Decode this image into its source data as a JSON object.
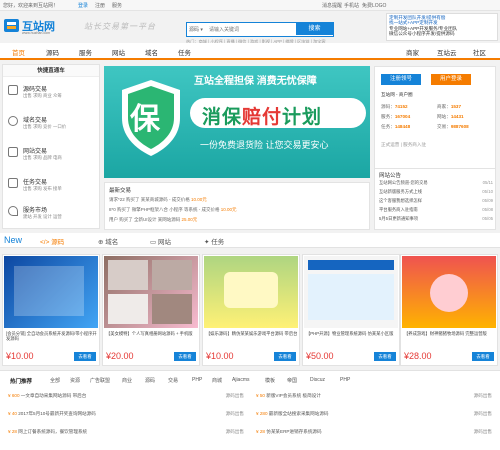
{
  "topbar": {
    "welcome": "您好，欢迎来到互站网！",
    "login": "登录",
    "register": "注册",
    "service": "服务",
    "items": [
      "消息提醒",
      "手机站",
      "免费LOGO",
      "服务中心",
      "网站导航"
    ]
  },
  "ad": {
    "line1": "定制开发团队开发/提供有偿",
    "line2": "找一站式+APP定制开发",
    "line3": "专业网站+APP开发服务/专业团队",
    "line4": "微信公众号小程序开发/提供源码"
  },
  "header": {
    "logo_text": "互站网",
    "logo_sub": "www.huzhan.com",
    "slogan": "站长交易第一平台",
    "search_select": "源码",
    "search_placeholder": "请输入关键词",
    "search_button": "搜索",
    "hot_keywords": "热门：商城 | 小程序 | 直播 | 微信 | 游戏 | 影视 | APP | 棋牌 | 区块链 | 淘宝客"
  },
  "nav": {
    "items": [
      "首页",
      "源码",
      "服务",
      "网站",
      "域名",
      "任务"
    ],
    "right_items": [
      "商家",
      "互站云",
      "社区"
    ]
  },
  "leftmenu": {
    "title": "快捷直通车",
    "cats": [
      {
        "title": "源码交易",
        "sub": "出售 求购 商业 众筹"
      },
      {
        "title": "域名交易",
        "sub": "出售 求购 竞价 一口价"
      },
      {
        "title": "网站交易",
        "sub": "出售 求购 品牌 电商"
      },
      {
        "title": "任务交易",
        "sub": "出售 求购 发布 接单"
      },
      {
        "title": "服务市场",
        "sub": "建站 开发 设计 运营"
      }
    ]
  },
  "banner": {
    "tagline": "互站全程担保  消费无忧保障",
    "headline_a": "消保",
    "headline_b": "赔付",
    "headline_c": "计划",
    "sub": "一份免费退货险  让您交易更安心",
    "shield_char": "保"
  },
  "userbox": {
    "login_button": "注册领号",
    "register_button": "用户登录",
    "greeting": "互站网 - 商户圈",
    "stats": [
      {
        "label": "源码",
        "value": "74152",
        "label2": "商家",
        "value2": "1537"
      },
      {
        "label": "服务",
        "value": "167004",
        "label2": "网站",
        "value2": "14431"
      },
      {
        "label": "任务",
        "value": "148448",
        "label2": "交易",
        "value2": "9887608"
      }
    ]
  },
  "notices": {
    "tabs": "正式运营 | 服务商入驻",
    "title": "网站公告",
    "items": [
      {
        "text": "互站网公告频道-您的交易",
        "date": "05/11"
      },
      {
        "text": "互站新版服务方式上线",
        "date": "05/10"
      },
      {
        "text": "这个客服我想选择怎样",
        "date": "05/09"
      },
      {
        "text": "平台服务商入驻指南",
        "date": "05/08"
      },
      {
        "text": "5月5日更新通知事项",
        "date": "05/05"
      }
    ]
  },
  "deals": {
    "title": "最新交易",
    "items": [
      {
        "text": "请求*22 购买了 某某商城源码 - 成交价格",
        "price": "10.00元"
      },
      {
        "text": "8*0 购买了 微擎PHP框架八合 小程序 等系统 - 成交价格",
        "price": "10.00元"
      },
      {
        "text": "用户 购买了 全新UI设计 某网站源码",
        "price": "25.00元"
      }
    ]
  },
  "newtabs": {
    "new_label": "New",
    "tabs": [
      "源码",
      "域名",
      "网站",
      "任务"
    ]
  },
  "cards": [
    {
      "title": "[会员分销] 全自动会员系统开发源码/带小程序开发源码",
      "price": "¥10.00",
      "button": "去看看"
    },
    {
      "title": "【美女模特】个人写真相册网站源码 + 手机版",
      "price": "¥20.00",
      "button": "去看看"
    },
    {
      "title": "【娱乐源码】精仿某某娱乐游戏平台源码 带后台",
      "price": "¥10.00",
      "button": "去看看"
    },
    {
      "title": "【PHP开源】物业管理系统源码 仿某某小区版",
      "price": "¥50.00",
      "button": "去看看"
    },
    {
      "title": "【养成游戏】财神猪猪牧场源码 完整运营版",
      "price": "¥28.00",
      "button": "去看看"
    }
  ],
  "lower": {
    "tabs": [
      "热门推荐",
      "全部",
      "资源",
      "广告联盟",
      "商业",
      "源码",
      "交易",
      "PHP",
      "商城",
      "Ajiacms",
      "模板",
      "帝国",
      "Discuz",
      "PHP"
    ],
    "left_rows": [
      {
        "price": "¥ 600",
        "text": "一文章自动采集网站源码 带后台",
        "cat": "源码出售"
      },
      {
        "price": "¥ 40",
        "text": "2017年5月10号最新开奖查询网站源码",
        "cat": "源码出售"
      },
      {
        "price": "¥ 28",
        "text": "网上订餐系统源码，餐饮管理系统",
        "cat": "源码出售"
      }
    ],
    "right_rows": [
      {
        "price": "¥ 50",
        "text": "新版VIP会员系统 极简设计",
        "cat": "源码出售"
      },
      {
        "price": "¥ 280",
        "text": "最新版全站搜索采集网站源码",
        "cat": "源码出售"
      },
      {
        "price": "¥ 28",
        "text": "仿某某ERP进销存系统源码",
        "cat": "源码出售"
      }
    ]
  },
  "colors": {
    "brand_blue": "#1583d8",
    "accent_orange": "#f57c00",
    "banner_teal": "#1ba6a3",
    "price_red": "#e53935"
  }
}
